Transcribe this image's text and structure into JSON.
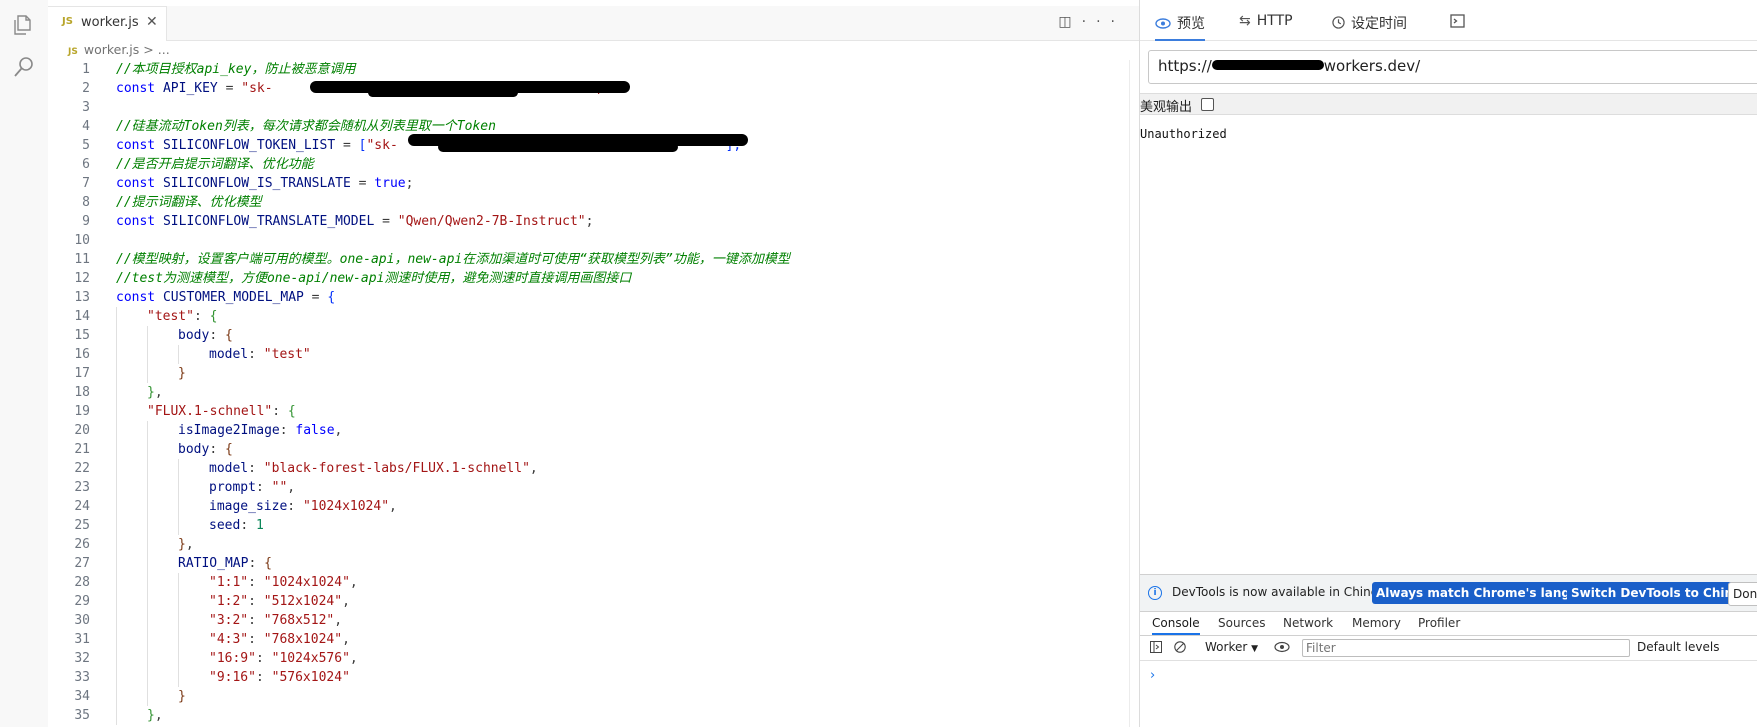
{
  "activity_bar": {
    "icons": [
      "explorer-icon",
      "search-icon"
    ]
  },
  "editor": {
    "tab": {
      "badge": "JS",
      "label": "worker.js",
      "close": "✕"
    },
    "actions": {
      "split": "◫",
      "more": "···"
    },
    "breadcrumb": {
      "badge": "JS",
      "file": "worker.js",
      "sep": ">",
      "rest": "..."
    },
    "line_numbers": [
      "1",
      "2",
      "3",
      "4",
      "5",
      "6",
      "7",
      "8",
      "9",
      "10",
      "11",
      "12",
      "13",
      "14",
      "15",
      "16",
      "17",
      "18",
      "19",
      "20",
      "21",
      "22",
      "23",
      "24",
      "25",
      "26",
      "27",
      "28",
      "29",
      "30",
      "31",
      "32",
      "33",
      "34",
      "35"
    ],
    "code": {
      "l1_comment": "//本项目授权api_key，防止被恶意调用",
      "kw_const": "const",
      "l2_var": "API_KEY",
      "eq": " = ",
      "l2_str_start": "\"sk-",
      "l2_str_end": "\";",
      "l4_comment": "//硅基流动Token列表，每次请求都会随机从列表里取一个Token",
      "l5_var": "SILICONFLOW_TOKEN_LIST",
      "l5_open": "[",
      "l5_str_start": "\"sk-",
      "l5_str_end": "\"",
      "l5_close": "];",
      "l6_comment": "//是否开启提示词翻译、优化功能",
      "l7_var": "SILICONFLOW_IS_TRANSLATE",
      "l7_val": "true",
      "semi": ";",
      "l8_comment": "//提示词翻译、优化模型",
      "l9_var": "SILICONFLOW_TRANSLATE_MODEL",
      "l9_str": "\"Qwen/Qwen2-7B-Instruct\"",
      "l11_comment": "//模型映射，设置客户端可用的模型。one-api，new-api在添加渠道时可使用“获取模型列表”功能，一键添加模型",
      "l12_comment": "//test为测速模型，方便one-api/new-api测速时使用，避免测速时直接调用画图接口",
      "l13_var": "CUSTOMER_MODEL_MAP",
      "open_brace": "{",
      "close_brace": "}",
      "close_brace_comma": "},",
      "colon": ": ",
      "comma": ",",
      "l14_key": "\"test\"",
      "k_body": "body",
      "k_model": "model",
      "l16_val": "\"test\"",
      "l19_key": "\"FLUX.1-schnell\"",
      "k_isImage2Image": "isImage2Image",
      "v_false": "false",
      "l22_val": "\"black-forest-labs/FLUX.1-schnell\"",
      "k_prompt": "prompt",
      "l23_val": "\"\"",
      "k_image_size": "image_size",
      "l24_val": "\"1024x1024\"",
      "k_seed": "seed",
      "l25_val": "1",
      "k_ratio_map": "RATIO_MAP",
      "ratio_keys": [
        "\"1:1\"",
        "\"1:2\"",
        "\"3:2\"",
        "\"4:3\"",
        "\"16:9\"",
        "\"9:16\""
      ],
      "ratio_vals": [
        "\"1024x1024\"",
        "\"512x1024\"",
        "\"768x512\"",
        "\"768x1024\"",
        "\"1024x576\"",
        "\"576x1024\""
      ]
    }
  },
  "preview": {
    "tabs": [
      {
        "icon": "eye-icon",
        "label": "预览"
      },
      {
        "icon": "swap-icon",
        "label": "HTTP"
      },
      {
        "icon": "clock-icon",
        "label": "设定时间"
      },
      {
        "icon": "terminal-icon",
        "label": ""
      }
    ],
    "url_prefix": "https://",
    "url_suffix": "workers.dev/",
    "pretty_label": "美观输出",
    "pretty_checked": false,
    "response_body": "Unauthorized"
  },
  "devtools": {
    "info": "DevTools is now available in Chinese!",
    "btn_match": "Always match Chrome's language",
    "btn_switch": "Switch DevTools to Chinese",
    "btn_dont": "Don't",
    "tabs": [
      "Console",
      "Sources",
      "Network",
      "Memory",
      "Profiler"
    ],
    "active_tab": "Console",
    "context": "Worker",
    "context_arrow": "▼",
    "filter_placeholder": "Filter",
    "levels": "Default levels",
    "prompt": "›",
    "colors": {
      "accent": "#1a5fc9",
      "link": "#1a73e8"
    }
  }
}
